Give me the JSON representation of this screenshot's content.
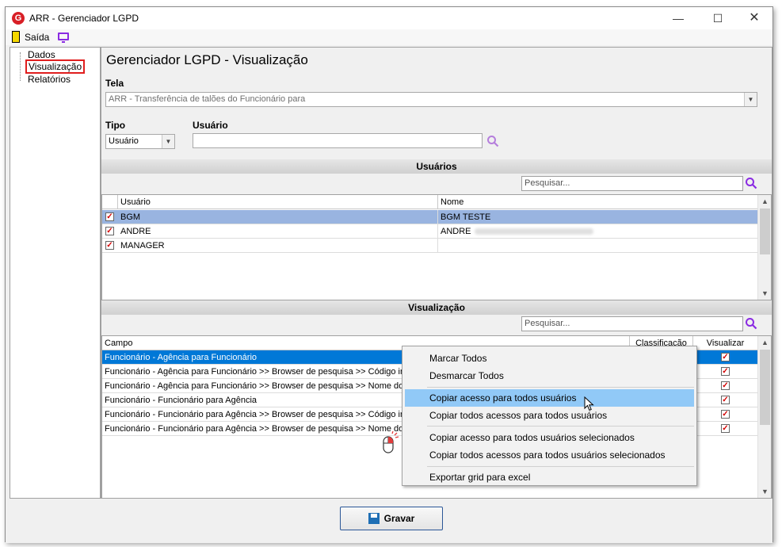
{
  "window": {
    "title": "ARR - Gerenciador LGPD",
    "logo_letter": "G"
  },
  "toolbar": {
    "exit_label": "Saída"
  },
  "nav": {
    "items": [
      {
        "label": "Dados"
      },
      {
        "label": "Visualização"
      },
      {
        "label": "Relatórios"
      }
    ]
  },
  "page": {
    "title": "Gerenciador LGPD - Visualização",
    "tela_label": "Tela",
    "tela_value": "ARR - Transferência de talões do Funcionário para",
    "tipo_label": "Tipo",
    "tipo_value": "Usuário",
    "usuario_label": "Usuário",
    "usuario_value": ""
  },
  "users_section": {
    "title": "Usuários",
    "search_placeholder": "Pesquisar...",
    "columns": [
      "Usuário",
      "Nome"
    ],
    "rows": [
      {
        "user": "BGM",
        "name": "BGM TESTE",
        "checked": true
      },
      {
        "user": "ANDRE",
        "name": "ANDRE",
        "checked": true
      },
      {
        "user": "MANAGER",
        "name": "",
        "checked": true
      }
    ]
  },
  "view_section": {
    "title": "Visualização",
    "search_placeholder": "Pesquisar...",
    "columns": [
      "Campo",
      "Classificação",
      "Visualizar"
    ],
    "rows": [
      {
        "campo": "Funcionário - Agência para Funcionário",
        "class": "",
        "visible": true
      },
      {
        "campo": "Funcionário - Agência para Funcionário >> Browser de pesquisa >> Código intern",
        "class": "",
        "visible": true
      },
      {
        "campo": "Funcionário - Agência para Funcionário >> Browser de pesquisa >> Nome do fun",
        "class": "",
        "visible": true
      },
      {
        "campo": "Funcionário - Funcionário para Agência",
        "class": "",
        "visible": true
      },
      {
        "campo": "Funcionário - Funcionário para Agência >> Browser de pesquisa >> Código intern",
        "class": "",
        "visible": true
      },
      {
        "campo": "Funcionário - Funcionário para Agência >> Browser de pesquisa >> Nome do fun",
        "class": "",
        "visible": true
      }
    ]
  },
  "context_menu": {
    "items": [
      "Marcar Todos",
      "Desmarcar Todos",
      "Copiar acesso para todos usuários",
      "Copiar todos acessos para todos usuários",
      "Copiar acesso para todos usuários selecionados",
      "Copiar todos acessos para todos usuários selecionados",
      "Exportar grid para excel"
    ]
  },
  "footer": {
    "save_label": "Gravar"
  },
  "colors": {
    "accent": "#0078d7",
    "row_selected": "#99b4e0",
    "menu_highlight": "#91c9f7",
    "check_red": "#d40000",
    "search_icon": "#8a2be2",
    "nav_highlight_border": "#e01e1e"
  }
}
